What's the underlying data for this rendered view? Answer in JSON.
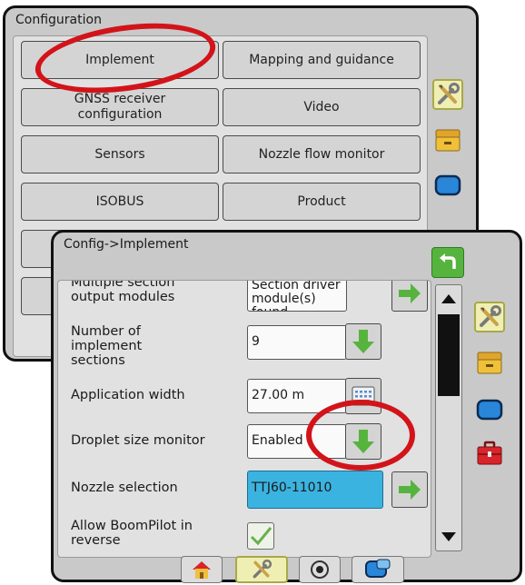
{
  "config_panel": {
    "title": "Configuration",
    "buttons": [
      {
        "label": "Implement"
      },
      {
        "label": "Mapping and guidance"
      },
      {
        "label": "GNSS receiver configuration"
      },
      {
        "label": "Video"
      },
      {
        "label": "Sensors"
      },
      {
        "label": "Nozzle flow monitor"
      },
      {
        "label": "ISOBUS"
      },
      {
        "label": "Product"
      }
    ]
  },
  "implement_panel": {
    "title": "Config->Implement",
    "rows": [
      {
        "label": "Multiple section output modules",
        "value": "Section driver module(s) found"
      },
      {
        "label": "Number of implement sections",
        "value": "9"
      },
      {
        "label": "Application width",
        "value": "27.00 m"
      },
      {
        "label": "Droplet size monitor",
        "value": "Enabled"
      },
      {
        "label": "Nozzle selection",
        "value": "TTJ60-11010"
      },
      {
        "label": "Allow BoomPilot in reverse",
        "value": ""
      }
    ]
  },
  "side_tabs": [
    "tools-icon",
    "console-icon",
    "screen-icon",
    "toolbox-icon"
  ],
  "bottom_nav": [
    "home-icon",
    "tools-icon",
    "camera-icon",
    "guidance-icon"
  ],
  "colors": {
    "highlight_red": "#d2141a",
    "arrow_green": "#56b43e",
    "selected_field": "#3bb3e0",
    "panel": "#c9c9c9"
  }
}
